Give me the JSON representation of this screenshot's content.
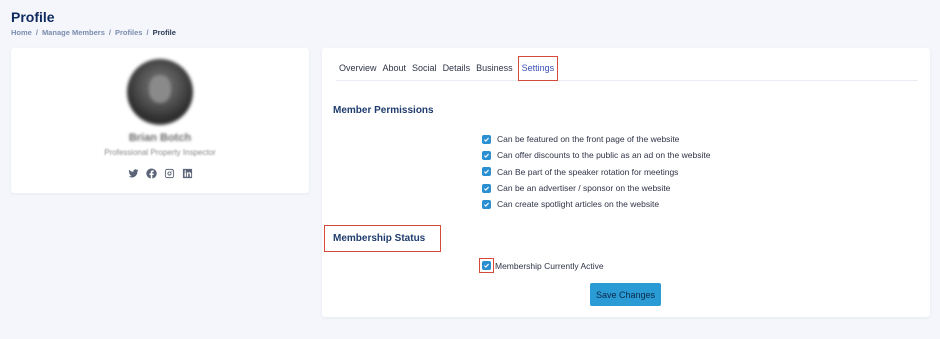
{
  "page": {
    "title": "Profile",
    "breadcrumb": [
      "Home",
      "Manage Members",
      "Profiles",
      "Profile"
    ],
    "separator": "/"
  },
  "profile": {
    "name": "Brian Botch",
    "role": "Professional Property Inspector",
    "socials": [
      "twitter-icon",
      "facebook-icon",
      "instagram-icon",
      "linkedin-icon"
    ]
  },
  "tabs": [
    "Overview",
    "About",
    "Social",
    "Details",
    "Business",
    "Settings"
  ],
  "active_tab": "Settings",
  "permissions": {
    "title": "Member Permissions",
    "items": [
      {
        "label": "Can be featured on the front page of the website",
        "checked": true
      },
      {
        "label": "Can offer discounts to the public as an ad on the website",
        "checked": true
      },
      {
        "label": "Can Be part of the speaker rotation for meetings",
        "checked": true
      },
      {
        "label": "Can be an advertiser / sponsor on the website",
        "checked": true
      },
      {
        "label": "Can create spotlight articles on the website",
        "checked": true
      }
    ]
  },
  "membership": {
    "title": "Membership Status",
    "label": "Membership Currently Active",
    "checked": true
  },
  "save_label": "Save Changes",
  "colors": {
    "accent": "#2a9bd4",
    "checkbox": "#2a8fd0",
    "highlight": "#d64a3b",
    "title": "#0f2a5f"
  }
}
